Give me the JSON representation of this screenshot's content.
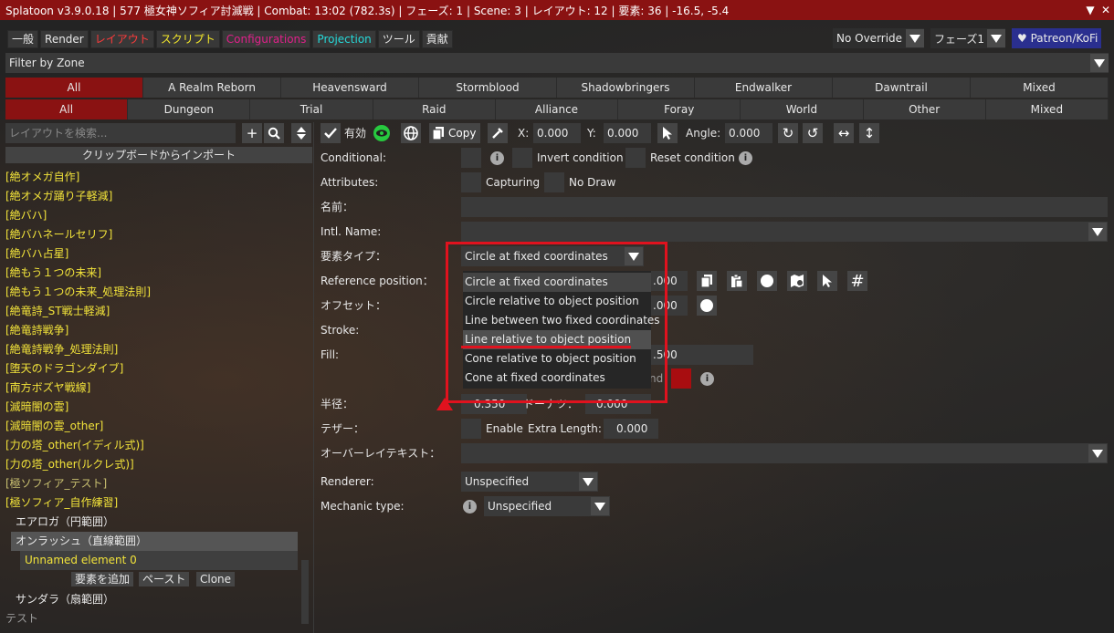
{
  "titlebar": {
    "title": "Splatoon v3.9.0.18 | 577 極女神ソフィア討滅戦 | Combat: 13:02 (782.3s) | フェーズ: 1 | Scene: 3 | レイアウト: 12 | 要素: 36 | -16.5, -5.4",
    "collapse_icon": "▼",
    "close_icon": "✕"
  },
  "tabs": [
    {
      "label": "一般",
      "color": "#ffffff"
    },
    {
      "label": "Render",
      "color": "#ffffff"
    },
    {
      "label": "レイアウト",
      "color": "#ff3b3b"
    },
    {
      "label": "スクリプト",
      "color": "#f6ea2a"
    },
    {
      "label": "Configurations",
      "color": "#e0208a"
    },
    {
      "label": "Projection",
      "color": "#26d9d9"
    },
    {
      "label": "ツール",
      "color": "#ffffff"
    },
    {
      "label": "貢献",
      "color": "#ffffff"
    }
  ],
  "topright": {
    "override": "No Override",
    "phase": "フェーズ1",
    "patreon": "♥ Patreon/KoFi"
  },
  "filter": {
    "label": "Filter by Zone"
  },
  "zones_row1": [
    "All",
    "A Realm Reborn",
    "Heavensward",
    "Stormblood",
    "Shadowbringers",
    "Endwalker",
    "Dawntrail",
    "Mixed"
  ],
  "zones_row2": [
    "All",
    "Dungeon",
    "Trial",
    "Raid",
    "Alliance",
    "Foray",
    "World",
    "Other",
    "Mixed"
  ],
  "left": {
    "search_placeholder": "レイアウトを検索...",
    "import_label": "クリップボードからインポート",
    "layouts": [
      "[絶オメガ自作]",
      "[絶オメガ踊り子軽減]",
      "[絶バハ]",
      "[絶バハネールセリフ]",
      "[絶バハ占星]",
      "[絶もう１つの未来]",
      "[絶もう１つの未来_処理法則]",
      "[絶竜詩_ST戦士軽減]",
      "[絶竜詩戦争]",
      "[絶竜詩戦争_処理法則]",
      "[堕天のドラゴンダイブ]",
      "[南方ボズヤ戦線]",
      "[滅暗闇の雲]",
      "[滅暗闇の雲_other]",
      "[力の塔_other(イディル式)]",
      "[力の塔_other(ルクレ式)]",
      "[極ソフィア_テスト]",
      "[極ソフィア_自作練習]"
    ],
    "sub_items": {
      "aeroga": "エアロガ（円範囲）",
      "onrush": "オンラッシュ（直線範囲）",
      "unnamed": "Unnamed element 0",
      "add_element": "要素を追加",
      "paste": "ペースト",
      "clone": "Clone",
      "thundara": "サンダラ（扇範囲）",
      "test": "テスト"
    }
  },
  "toolbar": {
    "enabled_label": "有効",
    "copy_label": "Copy",
    "x_label": "X:",
    "x_value": "0.000",
    "y_label": "Y:",
    "y_value": "0.000",
    "angle_label": "Angle:",
    "angle_value": "0.000"
  },
  "form": {
    "conditional": "Conditional:",
    "invert_condition": "Invert condition",
    "reset_condition": "Reset condition",
    "attributes": "Attributes:",
    "capturing": "Capturing",
    "no_draw": "No Draw",
    "name": "名前：",
    "intl_name": "Intl. Name:",
    "element_type": "要素タイプ：",
    "element_type_value": "Circle at fixed coordinates",
    "reference_position": "Reference position：",
    "ref_value": ".000",
    "offset": "オフセット：",
    "offset_value": ".000",
    "stroke": "Stroke:",
    "fill": "Fill:",
    "fill_value": ".500",
    "fill_hidden_label": "nd",
    "radius": "半径：",
    "radius_value": "0.350",
    "donut_label": "ドーナツ：",
    "donut_value": "0.000",
    "tether": "テザー：",
    "enable": "Enable",
    "extra_length": "Extra Length:",
    "extra_length_value": "0.000",
    "overlay_text": "オーバーレイテキスト：",
    "renderer": "Renderer:",
    "renderer_value": "Unspecified",
    "mechanic_type": "Mechanic type:",
    "mechanic_value": "Unspecified",
    "fill_color": "#a80d10"
  },
  "dropdown": {
    "items": [
      "Circle at fixed coordinates",
      "Circle relative to object position",
      "Line between two fixed coordinates",
      "Line relative to object position",
      "Cone relative to object position",
      "Cone at fixed coordinates"
    ],
    "current_index": 0,
    "hover_index": 3
  },
  "annotation": {
    "color": "#e0121e"
  }
}
